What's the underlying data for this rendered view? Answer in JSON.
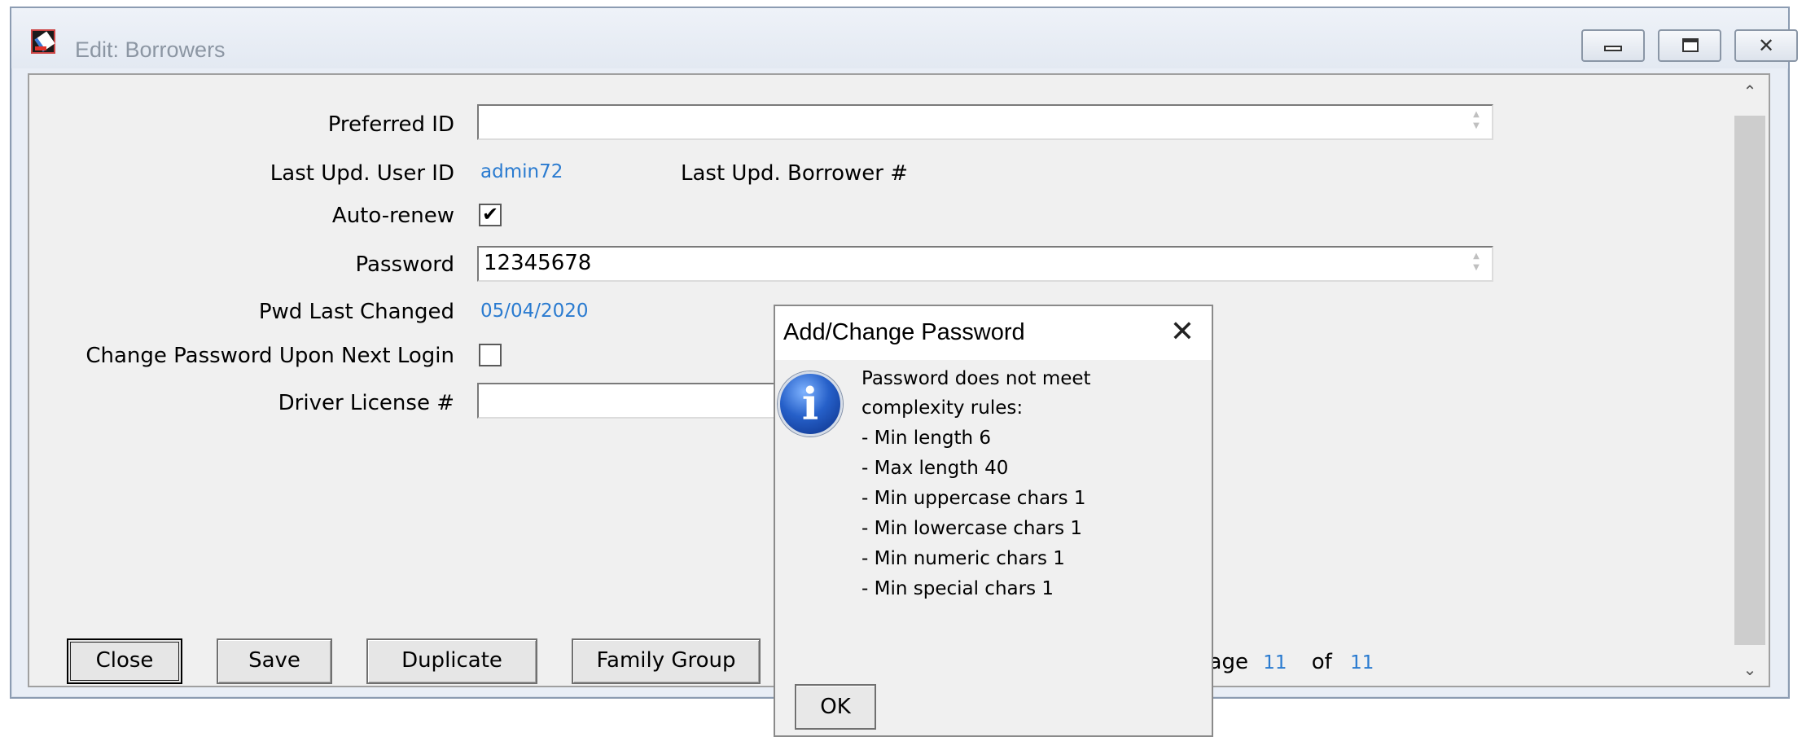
{
  "window": {
    "title": "Edit: Borrowers"
  },
  "form": {
    "preferred_id_label": "Preferred ID",
    "preferred_id_value": "",
    "last_upd_user_label": "Last Upd. User ID",
    "last_upd_user_value": "admin72",
    "last_upd_borrower_label": "Last Upd. Borrower #",
    "auto_renew_label": "Auto-renew",
    "auto_renew_checked": true,
    "password_label": "Password",
    "password_value": "12345678",
    "pwd_last_changed_label": "Pwd Last Changed",
    "pwd_last_changed_value": "05/04/2020",
    "change_pwd_label": "Change Password Upon Next Login",
    "change_pwd_checked": false,
    "driver_license_label": "Driver License #",
    "driver_license_value": ""
  },
  "buttons": {
    "close": "Close",
    "save": "Save",
    "duplicate": "Duplicate",
    "family_group": "Family Group"
  },
  "pager": {
    "page_label": "Page",
    "current": "11",
    "of_label": "of",
    "total": "11"
  },
  "dialog": {
    "title": "Add/Change Password",
    "icon": "info-icon",
    "message_lines": [
      "Password does not meet",
      "complexity rules:",
      "- Min length 6",
      "- Max length 40",
      "- Min uppercase chars 1",
      "- Min lowercase chars 1",
      "- Min numeric chars 1",
      "- Min special chars 1"
    ],
    "ok_label": "OK"
  }
}
